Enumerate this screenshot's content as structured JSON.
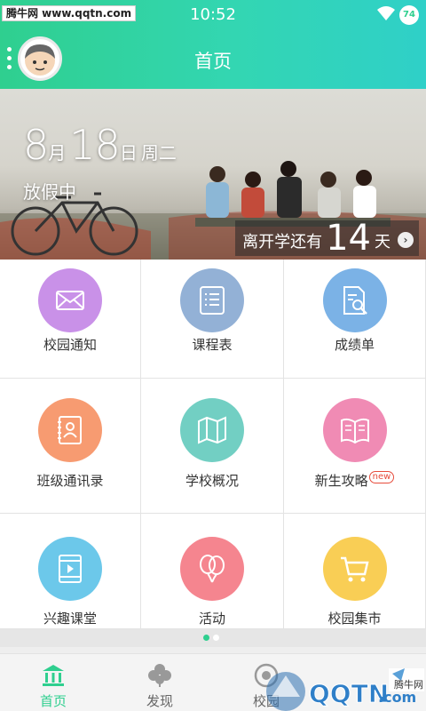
{
  "status_bar": {
    "watermark": "腾牛网 www.qqtn.com",
    "time": "10:52",
    "battery": "74"
  },
  "header": {
    "title": "首页"
  },
  "banner": {
    "month": "8",
    "month_unit": "月",
    "day": "18",
    "day_unit": "日",
    "weekday": "周二",
    "status": "放假中",
    "countdown_prefix": "离开学还有",
    "countdown_days": "14",
    "countdown_suffix": "天"
  },
  "grid": [
    {
      "label": "校园通知",
      "icon": "envelope-icon",
      "color": "#c991e8"
    },
    {
      "label": "课程表",
      "icon": "list-icon",
      "color": "#93b1d6"
    },
    {
      "label": "成绩单",
      "icon": "document-search-icon",
      "color": "#7bb2e6"
    },
    {
      "label": "班级通讯录",
      "icon": "contacts-book-icon",
      "color": "#f79b71"
    },
    {
      "label": "学校概况",
      "icon": "map-icon",
      "color": "#72cfc3"
    },
    {
      "label": "新生攻略",
      "badge": "new",
      "icon": "open-book-icon",
      "color": "#f08bb4"
    },
    {
      "label": "兴趣课堂",
      "icon": "video-icon",
      "color": "#6cc8ea"
    },
    {
      "label": "活动",
      "icon": "balloons-icon",
      "color": "#f5858f"
    },
    {
      "label": "校园集市",
      "icon": "cart-icon",
      "color": "#f9ce55"
    }
  ],
  "pager": {
    "active_color": "#2fcf8f",
    "inactive_color": "#ffffff"
  },
  "bottom_nav": [
    {
      "label": "首页",
      "icon": "school-icon",
      "active": true,
      "color": "#2fcf8f"
    },
    {
      "label": "发现",
      "icon": "clover-icon",
      "active": false,
      "color": "#888888"
    },
    {
      "label": "校园",
      "icon": "camera-icon",
      "active": false,
      "color": "#888888"
    }
  ],
  "watermark_bottom": {
    "brand": "QQTN",
    "suffix": ".com",
    "site": "腾牛网"
  }
}
